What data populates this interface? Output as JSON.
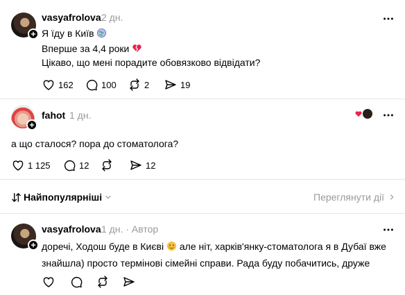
{
  "post": {
    "username": "vasyafrolova",
    "time": "2 дн.",
    "lines": [
      "Я їду в Київ",
      "Вперше за 4,4 роки",
      "Цікаво, що мені порадите обовязково відвідати?"
    ],
    "emojis": [
      "globe-icon",
      "broken-heart-icon"
    ],
    "likes": "162",
    "comments": "100",
    "reposts": "2",
    "shares": "19"
  },
  "reply": {
    "username": "fahot",
    "time": "1 дн.",
    "text": "а що сталося? пора до стоматолога?",
    "likes": "1 125",
    "comments": "12",
    "shares": "12"
  },
  "sort": {
    "label": "Найпопулярніші",
    "view_activity": "Переглянути дії"
  },
  "author_reply": {
    "username": "vasyafrolova",
    "time": "1 дн. · Автор",
    "text_a": "доречі, Ходош буде в Києві",
    "text_b": " але ніт, харків'янку-стоматолога я в Дубаї вже знайшла) просто термінові сімейні справи. Рада буду побачитись, друже"
  },
  "colors": {
    "accent": "#000000",
    "muted": "#999999",
    "divider": "#e5e5e5",
    "heart": "#e8234a"
  }
}
